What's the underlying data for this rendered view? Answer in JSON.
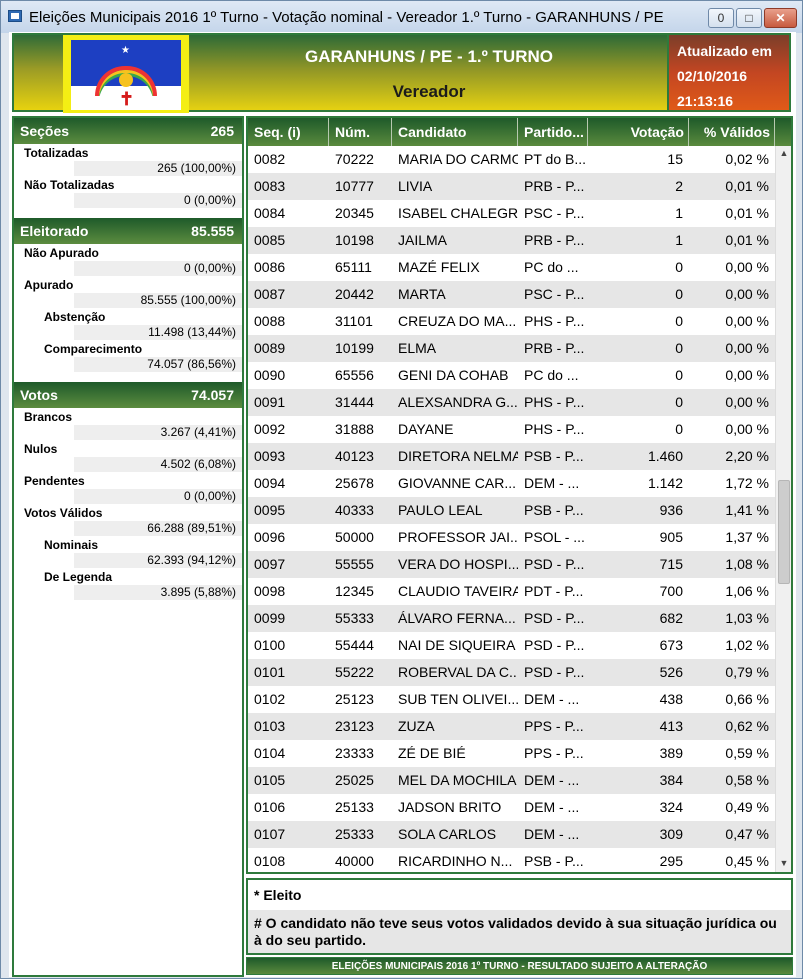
{
  "window": {
    "title": "Eleições Municipais 2016 1º Turno - Votação nominal - Vereador 1.º Turno - GARANHUNS / PE",
    "min_glyph": "0",
    "max_glyph": "□",
    "close_glyph": "✕"
  },
  "header": {
    "title": "GARANHUNS / PE - 1.º TURNO",
    "subtitle": "Vereador",
    "updated_label": "Atualizado em",
    "updated_date": "02/10/2016",
    "updated_time": "21:13:16"
  },
  "sidebar": {
    "secoes": {
      "label": "Seções",
      "value": "265",
      "rows": [
        {
          "label": "Totalizadas",
          "value": "265 (100,00%)"
        },
        {
          "label": "Não Totalizadas",
          "value": "0 (0,00%)"
        }
      ]
    },
    "eleitorado": {
      "label": "Eleitorado",
      "value": "85.555",
      "rows": [
        {
          "label": "Não Apurado",
          "value": "0 (0,00%)"
        },
        {
          "label": "Apurado",
          "value": "85.555 (100,00%)"
        },
        {
          "label": "Abstenção",
          "value": "11.498 (13,44%)"
        },
        {
          "label": "Comparecimento",
          "value": "74.057 (86,56%)"
        }
      ]
    },
    "votos": {
      "label": "Votos",
      "value": "74.057",
      "rows": [
        {
          "label": "Brancos",
          "value": "3.267 (4,41%)"
        },
        {
          "label": "Nulos",
          "value": "4.502 (6,08%)"
        },
        {
          "label": "Pendentes",
          "value": "0 (0,00%)"
        },
        {
          "label": "Votos Válidos",
          "value": "66.288 (89,51%)"
        },
        {
          "label": "Nominais",
          "value": "62.393 (94,12%)"
        },
        {
          "label": "De Legenda",
          "value": "3.895 (5,88%)"
        }
      ]
    }
  },
  "table": {
    "columns": [
      "Seq.   (i)",
      "Núm.",
      "Candidato",
      "Partido...",
      "Votação",
      "% Válidos"
    ],
    "rows": [
      [
        "0082",
        "70222",
        "MARIA DO CARMO",
        "PT do B...",
        "15",
        "0,02 %"
      ],
      [
        "0083",
        "10777",
        "LIVIA",
        "PRB - P...",
        "2",
        "0,01 %"
      ],
      [
        "0084",
        "20345",
        "ISABEL CHALEGRA",
        "PSC - P...",
        "1",
        "0,01 %"
      ],
      [
        "0085",
        "10198",
        "JAILMA",
        "PRB - P...",
        "1",
        "0,01 %"
      ],
      [
        "0086",
        "65111",
        "MAZÉ FELIX",
        "PC do ...",
        "0",
        "0,00 %"
      ],
      [
        "0087",
        "20442",
        "MARTA",
        "PSC - P...",
        "0",
        "0,00 %"
      ],
      [
        "0088",
        "31101",
        "CREUZA DO MA...",
        "PHS - P...",
        "0",
        "0,00 %"
      ],
      [
        "0089",
        "10199",
        "ELMA",
        "PRB - P...",
        "0",
        "0,00 %"
      ],
      [
        "0090",
        "65556",
        "GENI DA COHAB",
        "PC do ...",
        "0",
        "0,00 %"
      ],
      [
        "0091",
        "31444",
        "ALEXSANDRA G...",
        "PHS - P...",
        "0",
        "0,00 %"
      ],
      [
        "0092",
        "31888",
        "DAYANE",
        "PHS - P...",
        "0",
        "0,00 %"
      ],
      [
        "0093",
        "40123",
        "DIRETORA NELMA",
        "PSB - P...",
        "1.460",
        "2,20 %"
      ],
      [
        "0094",
        "25678",
        "GIOVANNE CAR...",
        "DEM - ...",
        "1.142",
        "1,72 %"
      ],
      [
        "0095",
        "40333",
        "PAULO LEAL",
        "PSB - P...",
        "936",
        "1,41 %"
      ],
      [
        "0096",
        "50000",
        "PROFESSOR JAI...",
        "PSOL - ...",
        "905",
        "1,37 %"
      ],
      [
        "0097",
        "55555",
        "VERA DO HOSPI...",
        "PSD - P...",
        "715",
        "1,08 %"
      ],
      [
        "0098",
        "12345",
        "CLAUDIO TAVEIRA",
        "PDT - P...",
        "700",
        "1,06 %"
      ],
      [
        "0099",
        "55333",
        "ÁLVARO FERNA...",
        "PSD - P...",
        "682",
        "1,03 %"
      ],
      [
        "0100",
        "55444",
        "NAI DE SIQUEIRA",
        "PSD - P...",
        "673",
        "1,02 %"
      ],
      [
        "0101",
        "55222",
        "ROBERVAL DA C...",
        "PSD - P...",
        "526",
        "0,79 %"
      ],
      [
        "0102",
        "25123",
        "SUB TEN OLIVEI...",
        "DEM - ...",
        "438",
        "0,66 %"
      ],
      [
        "0103",
        "23123",
        "ZUZA",
        "PPS - P...",
        "413",
        "0,62 %"
      ],
      [
        "0104",
        "23333",
        "ZÉ DE BIÉ",
        "PPS - P...",
        "389",
        "0,59 %"
      ],
      [
        "0105",
        "25025",
        "MEL DA MOCHILA",
        "DEM - ...",
        "384",
        "0,58 %"
      ],
      [
        "0106",
        "25133",
        "JADSON BRITO",
        "DEM - ...",
        "324",
        "0,49 %"
      ],
      [
        "0107",
        "25333",
        "SOLA CARLOS",
        "DEM - ...",
        "309",
        "0,47 %"
      ],
      [
        "0108",
        "40000",
        "RICARDINHO N...",
        "PSB - P...",
        "295",
        "0,45 %"
      ]
    ],
    "scroll_up": "▲",
    "scroll_down": "▼"
  },
  "notes": {
    "eleito": "* Eleito",
    "juridica": "# O candidato não teve seus votos validados devido à sua situação jurídica ou à do seu partido."
  },
  "footer": {
    "text": "ELEIÇÕES MUNICIPAIS 2016 1º TURNO - RESULTADO SUJEITO A ALTERAÇÃO"
  }
}
